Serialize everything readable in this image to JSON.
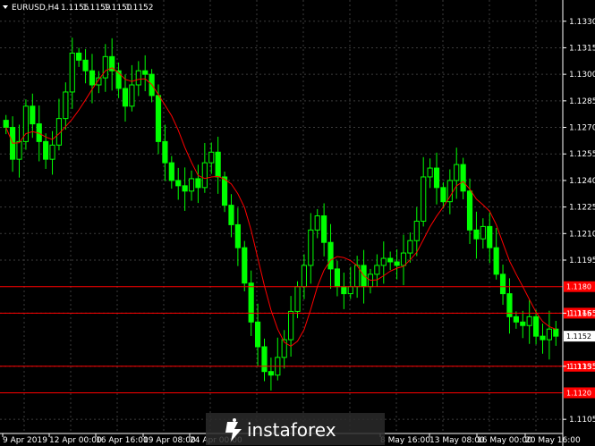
{
  "header": {
    "symbol": "EURUSD,H4",
    "open": "1.1155",
    "high": "1.1159",
    "low": "1.1150",
    "close": "1.1152"
  },
  "price_axis": {
    "ticks": [
      "1.1330",
      "1.1315",
      "1.1300",
      "1.1285",
      "1.1270",
      "1.1255",
      "1.1240",
      "1.1225",
      "1.1210",
      "1.1195",
      "1.1165",
      "1.1135",
      "1.1105"
    ],
    "current_price": "1.1152"
  },
  "time_axis": {
    "ticks": [
      "9 Apr 2019",
      "12 Apr 00:00",
      "16 Apr 16:00",
      "19 Apr 08:00",
      "24 Apr 00:00",
      "8 May 16:00",
      "13 May 08:00",
      "16 May 00:00",
      "20 May 16:00"
    ]
  },
  "levels": [
    {
      "label": "1.1180",
      "price": 1.118
    },
    {
      "label": "1.1165",
      "price": 1.1165
    },
    {
      "label": "1.1135",
      "price": 1.1135
    },
    {
      "label": "1.1120",
      "price": 1.112
    }
  ],
  "watermark": {
    "text": "instaforex"
  },
  "colors": {
    "background": "#000000",
    "candle": "#00ff00",
    "moving_average": "#ff0000",
    "level_line": "#ff0000",
    "level_label_bg": "#ff0000",
    "current_price_bg": "#ffffff"
  },
  "chart_data": {
    "type": "line",
    "title": "EURUSD,H4",
    "ylim": [
      1.1097,
      1.1342
    ],
    "series": [
      {
        "values": [
          1.127,
          1.1252,
          1.1262,
          1.1282,
          1.1272,
          1.1262,
          1.1252,
          1.126,
          1.1275,
          1.129,
          1.1312,
          1.1308,
          1.1302,
          1.1294,
          1.1298,
          1.131,
          1.1302,
          1.1292,
          1.1282,
          1.1294,
          1.1302,
          1.13,
          1.1288,
          1.1262,
          1.125,
          1.124,
          1.1237,
          1.1234,
          1.1241,
          1.1236,
          1.125,
          1.1256,
          1.1242,
          1.1226,
          1.1215,
          1.1202,
          1.1182,
          1.116,
          1.1146,
          1.1132,
          1.113,
          1.114,
          1.115,
          1.1166,
          1.118,
          1.1192,
          1.1212,
          1.122,
          1.1205,
          1.119,
          1.118,
          1.1176,
          1.118,
          1.1192,
          1.118,
          1.1187,
          1.1192,
          1.1196,
          1.1194,
          1.1192,
          1.1199,
          1.1206,
          1.1217,
          1.1242,
          1.1247,
          1.1236,
          1.1228,
          1.124,
          1.1249,
          1.1234,
          1.1212,
          1.1207,
          1.1214,
          1.1202,
          1.1187,
          1.1176,
          1.1163,
          1.116,
          1.1158,
          1.1163,
          1.1152,
          1.115,
          1.1156,
          1.1152
        ]
      }
    ]
  }
}
